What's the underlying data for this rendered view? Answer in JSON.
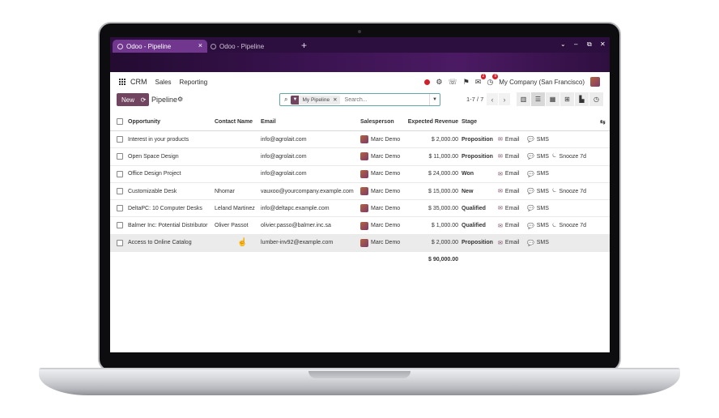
{
  "browser": {
    "tabs": [
      {
        "title": "Odoo - Pipeline",
        "active": true
      },
      {
        "title": "Odoo - Pipeline",
        "active": false
      }
    ],
    "new_tab": "+",
    "close_tab": "×",
    "window_controls": [
      "⌄",
      "–",
      "⧉",
      "✕"
    ]
  },
  "navbar": {
    "app_name": "CRM",
    "menus": [
      "Sales",
      "Reporting"
    ],
    "messages_badge": "2",
    "activities_badge": "9",
    "company": "My Company (San Francisco)"
  },
  "control_panel": {
    "new_label": "New",
    "breadcrumb": "Pipeline",
    "facet_label": "My Pipeline",
    "search_placeholder": "Search...",
    "pager": "1-7 / 7"
  },
  "table": {
    "headers": {
      "opportunity": "Opportunity",
      "contact": "Contact Name",
      "email": "Email",
      "salesperson": "Salesperson",
      "revenue": "Expected Revenue",
      "stage": "Stage"
    },
    "rows": [
      {
        "opportunity": "Interest in your products",
        "contact": "",
        "email": "info@agrolait.com",
        "salesperson": "Marc Demo",
        "revenue": "$ 2,000.00",
        "stage": "Proposition",
        "email_action": "Email",
        "sms_action": "SMS",
        "snooze": ""
      },
      {
        "opportunity": "Open Space Design",
        "contact": "",
        "email": "info@agrolait.com",
        "salesperson": "Marc Demo",
        "revenue": "$ 11,000.00",
        "stage": "Proposition",
        "email_action": "Email",
        "sms_action": "SMS",
        "snooze": "Snooze 7d"
      },
      {
        "opportunity": "Office Design Project",
        "contact": "",
        "email": "info@agrolait.com",
        "salesperson": "Marc Demo",
        "revenue": "$ 24,000.00",
        "stage": "Won",
        "email_action": "Email",
        "sms_action": "SMS",
        "snooze": ""
      },
      {
        "opportunity": "Customizable Desk",
        "contact": "Nhomar",
        "email": "vauxoo@yourcompany.example.com",
        "salesperson": "Marc Demo",
        "revenue": "$ 15,000.00",
        "stage": "New",
        "email_action": "Email",
        "sms_action": "SMS",
        "snooze": "Snooze 7d"
      },
      {
        "opportunity": "DeltaPC: 10 Computer Desks",
        "contact": "Leland Martinez",
        "email": "info@deltapc.example.com",
        "salesperson": "Marc Demo",
        "revenue": "$ 35,000.00",
        "stage": "Qualified",
        "email_action": "Email",
        "sms_action": "SMS",
        "snooze": ""
      },
      {
        "opportunity": "Balmer Inc: Potential Distributor",
        "contact": "Oliver Passot",
        "email": "olivier.passo@balmer.inc.sa",
        "salesperson": "Marc Demo",
        "revenue": "$ 1,000.00",
        "stage": "Qualified",
        "email_action": "Email",
        "sms_action": "SMS",
        "snooze": "Snooze 7d"
      },
      {
        "opportunity": "Access to Online Catalog",
        "contact": "",
        "email": "lumber-inv92@example.com",
        "salesperson": "Marc Demo",
        "revenue": "$ 2,000.00",
        "stage": "Proposition",
        "email_action": "Email",
        "sms_action": "SMS",
        "snooze": ""
      }
    ],
    "total": "$ 90,000.00"
  },
  "colors": {
    "brand": "#71445f",
    "tabbar": "#2d0f3f",
    "active_tab": "#71378f",
    "search_border": "#62a7a8"
  }
}
